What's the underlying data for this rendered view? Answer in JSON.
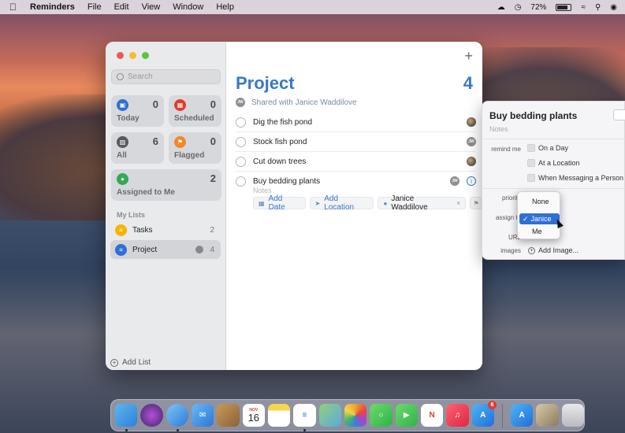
{
  "menubar": {
    "app_name": "Reminders",
    "items": [
      "File",
      "Edit",
      "View",
      "Window",
      "Help"
    ],
    "battery": "72%"
  },
  "sidebar": {
    "search_placeholder": "Search",
    "tiles": {
      "today": {
        "label": "Today",
        "count": "0",
        "color": "#2f6fd6"
      },
      "scheduled": {
        "label": "Scheduled",
        "count": "0",
        "color": "#e23b30"
      },
      "all": {
        "label": "All",
        "count": "6",
        "color": "#5a5a5e"
      },
      "flagged": {
        "label": "Flagged",
        "count": "0",
        "color": "#f1882a"
      },
      "assigned": {
        "label": "Assigned to Me",
        "count": "2",
        "color": "#34a853"
      }
    },
    "my_lists_header": "My Lists",
    "lists": [
      {
        "name": "Tasks",
        "count": "2",
        "color": "#f5b400"
      },
      {
        "name": "Project",
        "count": "4",
        "color": "#2f6fd6"
      }
    ],
    "add_list": "Add List"
  },
  "main": {
    "add_button": "+",
    "title": "Project",
    "count": "4",
    "shared_with": "Shared with Janice Waddilove",
    "avatar_initials": "JW",
    "tasks": [
      {
        "text": "Dig the fish pond"
      },
      {
        "text": "Stock fish pond"
      },
      {
        "text": "Cut down trees"
      },
      {
        "text": "Buy bedding plants"
      }
    ],
    "notes_placeholder": "Notes",
    "chips": {
      "add_date": "Add Date",
      "add_location": "Add Location",
      "assignee": "Janice Waddilove",
      "remove": "×"
    }
  },
  "inspector": {
    "title": "Buy bedding plants",
    "notes_placeholder": "Notes",
    "remind_me_label": "remind me",
    "options": [
      "On a Day",
      "At a Location",
      "When Messaging a Person"
    ],
    "priority_label": "priority",
    "assign_label": "assign to",
    "url_label": "URL",
    "images_label": "images",
    "add_image": "Add Image..."
  },
  "dropdown": {
    "options": [
      "None",
      "Janice",
      "Me"
    ],
    "selected": "Janice",
    "checkmark": "✓"
  },
  "dock": {
    "calendar_month": "NOV",
    "calendar_day": "16",
    "appstore_badge": "6"
  }
}
